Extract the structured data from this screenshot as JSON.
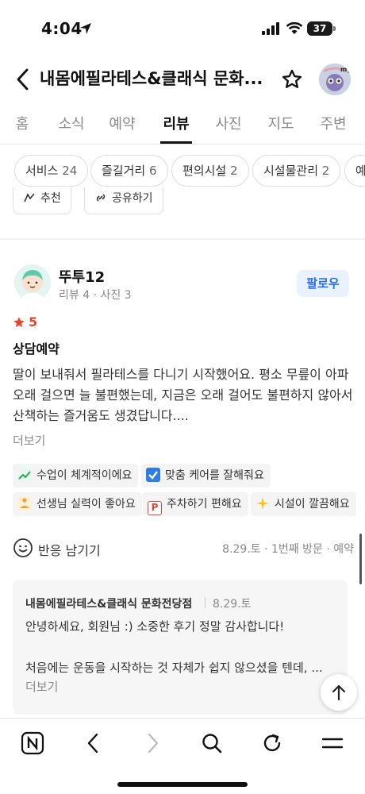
{
  "status_bar": {
    "time": "4:04",
    "battery": "37"
  },
  "header": {
    "title": "내몸에필라테스&클래식 문화..."
  },
  "tabs": [
    "홈",
    "소식",
    "예약",
    "리뷰",
    "사진",
    "지도",
    "주변"
  ],
  "active_tab": "리뷰",
  "filter_chips": [
    {
      "label": "서비스",
      "count": "24"
    },
    {
      "label": "즐길거리",
      "count": "6"
    },
    {
      "label": "편의시설",
      "count": "2"
    },
    {
      "label": "시설물관리",
      "count": "2"
    },
    {
      "label": "예",
      "count": ""
    }
  ],
  "previous_review_chips": [
    "추천",
    "공유하기"
  ],
  "review": {
    "author": "뚜투12",
    "meta": "리뷰 4 · 사진 3",
    "follow_label": "팔로우",
    "rating": "5",
    "visit_type": "상담예약",
    "body": "딸이 보내줘서 필라테스를 다니기 시작했어요. 평소 무릎이 아파 오래 걸으면 늘 불편했는데, 지금은 오래 걸어도 불편하지 않아서 산책하는 즐거움도 생겼답니다....",
    "more_label": "더보기",
    "keywords": [
      {
        "icon": "chart-up-icon",
        "label": "수업이 체계적이에요"
      },
      {
        "icon": "check-box-icon",
        "label": "맞춤 케어를 잘해줘요"
      },
      {
        "icon": "meditation-icon",
        "label": "선생님 실력이 좋아요"
      },
      {
        "icon": "parking-icon",
        "label": "주차하기 편해요"
      },
      {
        "icon": "sparkles-icon",
        "label": "시설이 깔끔해요"
      }
    ],
    "reaction_label": "반응 남기기",
    "visit_meta": "8.29.토 · 1번째 방문 · 예약"
  },
  "owner_reply": {
    "name": "내몸에필라테스&클래식 문화전당점",
    "date": "8.29.토",
    "line1": "안녕하세요, 회원님 :) 소중한 후기 정말 감사합니다!",
    "line2": "처음에는 운동을 시작하는 것 자체가 쉽지 않으셨을 텐데, ...",
    "more_label": "더보기"
  },
  "colors": {
    "accent_blue": "#2a6fe8",
    "star_red": "#e8452c"
  }
}
